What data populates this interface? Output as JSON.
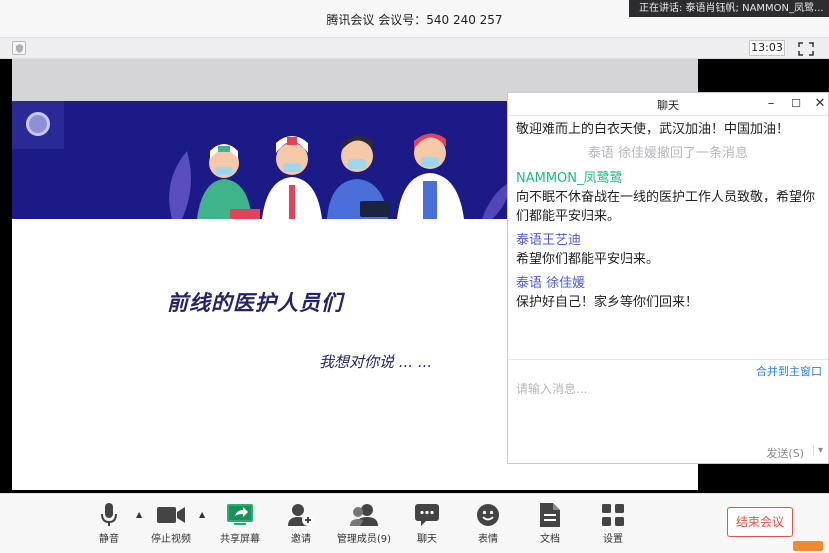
{
  "window": {
    "title": "腾讯会议 会议号：540 240 257",
    "speaking": "正在讲话: 泰语肖钰帆; NAMMON_凤鹭..."
  },
  "subbar": {
    "clock": "13:03"
  },
  "slide": {
    "title": "前线的医护人员们",
    "subtitle": "我想对你说 ... ..."
  },
  "chat": {
    "header": "聊天",
    "messages": [
      {
        "type": "text",
        "text": "敬迎难而上的白衣天使，武汉加油！中国加油！"
      },
      {
        "type": "system",
        "text": "泰语 徐佳媛撤回了一条消息"
      },
      {
        "type": "sender",
        "name": "NAMMON_凤鹭鹭",
        "text": "向不眠不休奋战在一线的医护工作人员致敬，希望你们都能平安归来。"
      },
      {
        "type": "sender",
        "name": "泰语王艺迪",
        "text": "希望你们都能平安归来。"
      },
      {
        "type": "sender",
        "name": "泰语 徐佳媛",
        "text": "保护好自己！家乡等你们回来！"
      }
    ],
    "merge_link": "合并到主窗口",
    "input_placeholder": "请输入消息...",
    "send_label": "发送(S)"
  },
  "toolbar": {
    "mute": "静音",
    "stop_video": "停止视频",
    "share": "共享屏幕",
    "invite": "邀请",
    "members": "管理成员(9)",
    "chat": "聊天",
    "reactions": "表情",
    "docs": "文档",
    "settings": "设置",
    "end": "结束会议"
  },
  "colors": {
    "banner": "#1c1a86",
    "accent_blue": "#4e5bd8",
    "accent_green": "#1bbd7e",
    "end_red": "#e0544a",
    "share_green": "#25b06f"
  }
}
